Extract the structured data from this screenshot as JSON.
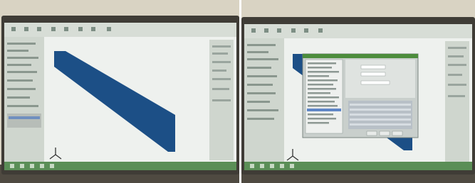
{
  "photos": [
    {
      "id": "left",
      "depicts": "monitor-showing-cad-window-with-sheet-part",
      "colors": {
        "bezel": "#3f3c36",
        "room_top": "#d9d3c3",
        "desk": "#4f4a41",
        "screen": "#eef1ee",
        "toolbar": "#d7ddd6",
        "panel": "#cfd6ce",
        "part": "#1c4f86",
        "taskbar": "#5a8e56"
      }
    },
    {
      "id": "right",
      "depicts": "monitor-showing-cad-window-with-open-dialog",
      "colors": {
        "bezel": "#3f3c36",
        "room_top": "#d9d3c3",
        "desk": "#4f4a41",
        "screen": "#eef1ee",
        "toolbar": "#d7ddd6",
        "panel": "#cfd6ce",
        "part": "#1c4f86",
        "dialog": "#c9cfcc",
        "dialog_title": "#4c8c3c",
        "taskbar": "#5a8e56"
      }
    }
  ]
}
